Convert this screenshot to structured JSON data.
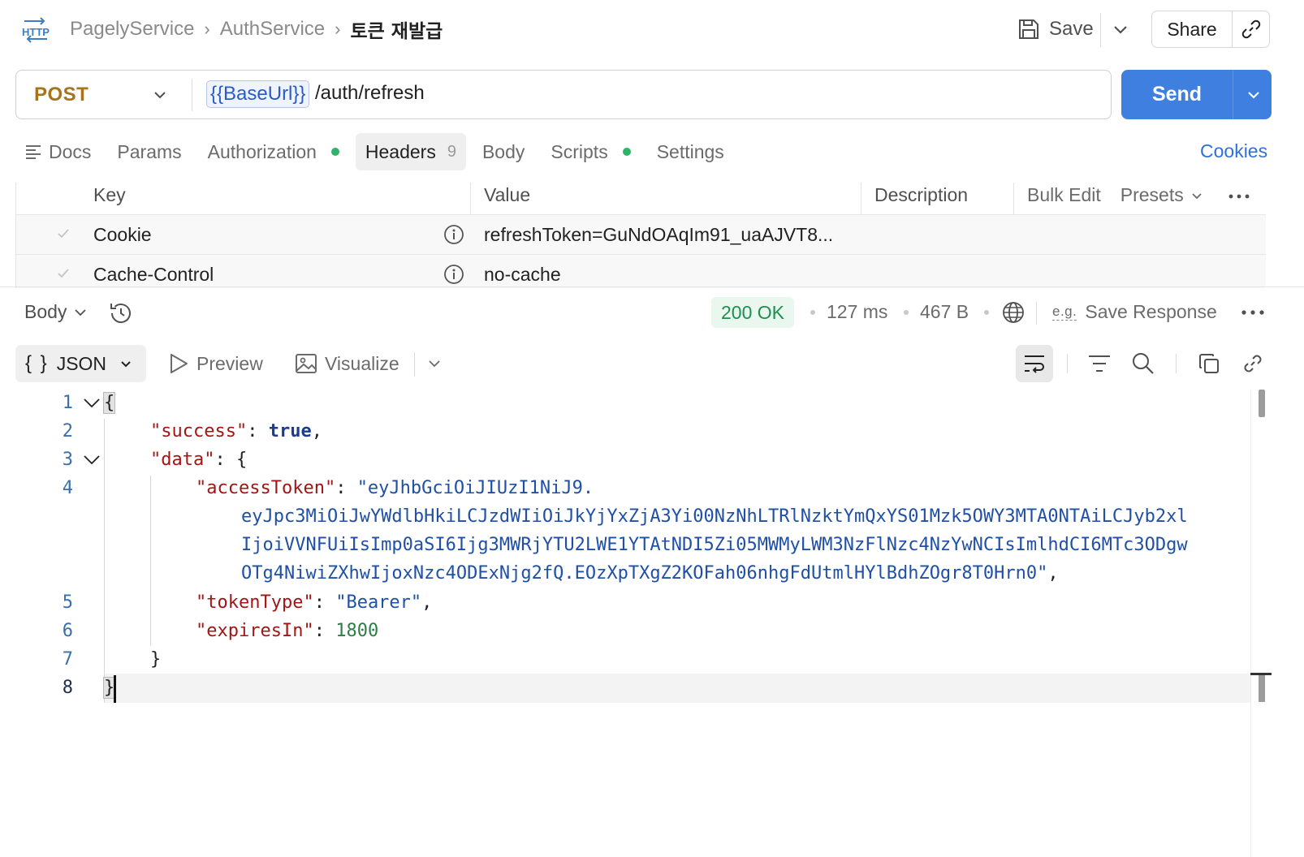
{
  "header": {
    "icon": "http-icon",
    "breadcrumb": [
      "PagelyService",
      "AuthService",
      "토큰 재발급"
    ],
    "save_label": "Save",
    "share_label": "Share"
  },
  "request": {
    "method": "POST",
    "base_url_var": "{{BaseUrl}}",
    "path": "/auth/refresh",
    "send_label": "Send"
  },
  "tabs": {
    "docs": "Docs",
    "params": "Params",
    "authorization": "Authorization",
    "headers": "Headers",
    "headers_count": "9",
    "body": "Body",
    "scripts": "Scripts",
    "settings": "Settings",
    "cookies": "Cookies"
  },
  "headers_table": {
    "columns": {
      "key": "Key",
      "value": "Value",
      "description": "Description"
    },
    "bulk_edit": "Bulk Edit",
    "presets": "Presets",
    "rows": [
      {
        "key": "Cookie",
        "value": "refreshToken=GuNdOAqIm91_uaAJVT8..."
      },
      {
        "key": "Cache-Control",
        "value": "no-cache"
      }
    ]
  },
  "response": {
    "body_label": "Body",
    "status": "200 OK",
    "time": "127 ms",
    "size": "467 B",
    "save_response": "Save Response",
    "eg_label": "e.g."
  },
  "viewer": {
    "format_braces": "{ }",
    "format": "JSON",
    "preview": "Preview",
    "visualize": "Visualize"
  },
  "code": {
    "line_numbers": [
      "1",
      "2",
      "3",
      "4",
      "5",
      "6",
      "7",
      "8"
    ],
    "open_brace": "{",
    "close_brace": "}",
    "close_brace_data": "}",
    "success_key": "\"success\"",
    "success_value": "true",
    "data_key": "\"data\"",
    "data_open": "{",
    "access_token_key": "\"accessToken\"",
    "access_token_lines": [
      "\"eyJhbGciOiJIUzI1NiJ9.",
      "eyJpc3MiOiJwYWdlbHkiLCJzdWIiOiJkYjYxZjA3Yi00NzNhLTRlNzktYmQxYS01Mzk5OWY3MTA0NTAiLCJyb2xl",
      "IjoiVVNFUiIsImp0aSI6Ijg3MWRjYTU2LWE1YTAtNDI5Zi05MWMyLWM3NzFlNzc4NzYwNCIsImlhdCI6MTc3ODgw",
      "OTg4NiwiZXhwIjoxNzc4ODExNjg2fQ.EOzXpTXgZ2KOFah06nhgFdUtmlHYlBdhZOgr8T0Hrn0\""
    ],
    "token_type_key": "\"tokenType\"",
    "token_type_value": "\"Bearer\"",
    "expires_in_key": "\"expiresIn\"",
    "expires_in_value": "1800"
  },
  "colors": {
    "accent": "#3f7fe0",
    "method": "#a7741b",
    "status_ok": "#1d8f4e",
    "json_key": "#a31515",
    "json_string": "#1f50a6",
    "json_number": "#2e7d46"
  }
}
